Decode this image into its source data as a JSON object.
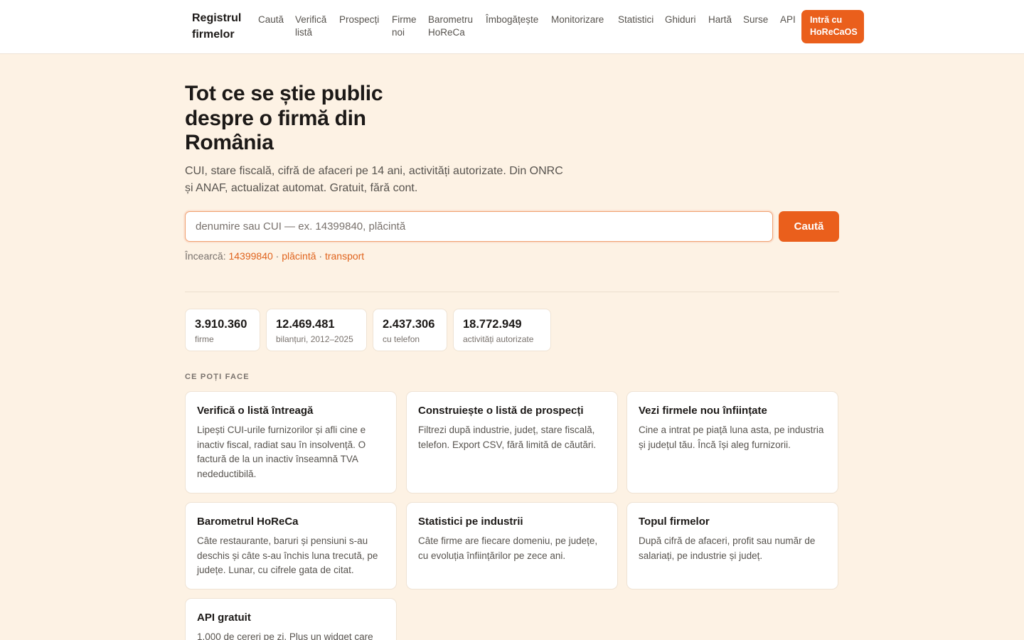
{
  "brand": {
    "name": "Registrul firmelor"
  },
  "nav": {
    "items": [
      {
        "label": "Caută"
      },
      {
        "label": "Verifică listă"
      },
      {
        "label": "Prospecți"
      },
      {
        "label": "Firme noi"
      },
      {
        "label": "Barometru HoReCa"
      },
      {
        "label": "Îmbogățește"
      },
      {
        "label": "Monitorizare"
      },
      {
        "label": "Statistici"
      },
      {
        "label": "Ghiduri"
      },
      {
        "label": "Hartă"
      },
      {
        "label": "Surse"
      },
      {
        "label": "API"
      }
    ],
    "cta_label": "Intră cu HoReCaOS"
  },
  "hero": {
    "title": "Tot ce se știe public despre o firmă din România",
    "subtitle": "CUI, stare fiscală, cifră de afaceri pe 14 ani, activități autorizate. Din ONRC și ANAF, actualizat automat. Gratuit, fără cont."
  },
  "search": {
    "placeholder": "denumire sau CUI — ex. 14399840, plăcintă",
    "value": "",
    "button_label": "Caută",
    "try_label": "Încearcă:",
    "separator": "·",
    "suggestions": [
      "14399840",
      "plăcintă",
      "transport"
    ]
  },
  "stats": [
    {
      "value": "3.910.360",
      "label": "firme"
    },
    {
      "value": "12.469.481",
      "label": "bilanțuri, 2012–2025"
    },
    {
      "value": "2.437.306",
      "label": "cu telefon"
    },
    {
      "value": "18.772.949",
      "label": "activități autorizate"
    }
  ],
  "features": {
    "section_label": "CE POȚI FACE",
    "cards": [
      {
        "title": "Verifică o listă întreagă",
        "description": "Lipești CUI-urile furnizorilor și afli cine e inactiv fiscal, radiat sau în insolvență. O factură de la un inactiv înseamnă TVA nedeductibilă."
      },
      {
        "title": "Construiește o listă de prospecți",
        "description": "Filtrezi după industrie, județ, stare fiscală, telefon. Export CSV, fără limită de căutări."
      },
      {
        "title": "Vezi firmele nou înființate",
        "description": "Cine a intrat pe piață luna asta, pe industria și județul tău. Încă își aleg furnizorii."
      },
      {
        "title": "Barometrul HoReCa",
        "description": "Câte restaurante, baruri și pensiuni s-au deschis și câte s-au închis luna trecută, pe județe. Lunar, cu cifrele gata de citat."
      },
      {
        "title": "Statistici pe industrii",
        "description": "Câte firme are fiecare domeniu, pe județe, cu evoluția înființărilor pe zece ani."
      },
      {
        "title": "Topul firmelor",
        "description": "După cifră de afaceri, profit sau număr de salariați, pe industrie și județ."
      },
      {
        "title": "API gratuit",
        "description": "1.000 de cereri pe zi. Plus un widget care"
      }
    ]
  },
  "colors": {
    "accent": "#ea5f1c",
    "background": "#fdf2e4",
    "card": "#ffffff",
    "text": "#1c1917",
    "muted": "#57534e"
  }
}
